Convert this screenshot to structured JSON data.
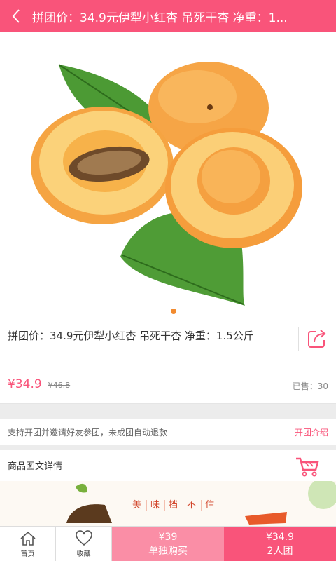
{
  "colors": {
    "accent": "#f9547a",
    "accent_light": "#fa8ea6",
    "dot": "#f28b2f"
  },
  "header": {
    "title": "拼团价：34.9元伊犁小红杏 吊死干杏 净重：1...",
    "back_icon": "chevron-left-icon"
  },
  "product": {
    "name": "拼团价：34.9元伊犁小红杏 吊死干杏 净重：1.5公斤",
    "price": "¥34.9",
    "original_price": "¥46.8",
    "sold": "已售：30",
    "share_icon": "share-icon"
  },
  "group_tip": {
    "text": "支持开团并邀请好友参团，未成团自动退款",
    "link": "开团介绍"
  },
  "detail": {
    "title": "商品图文详情",
    "cart_icon": "cart-icon",
    "banner_chars": [
      "美",
      "味",
      "挡",
      "不",
      "住"
    ]
  },
  "bottom_bar": {
    "home": "首页",
    "favorite": "收藏",
    "single_price": "¥39",
    "single_label": "单独购买",
    "group_price": "¥34.9",
    "group_label": "2人团"
  }
}
